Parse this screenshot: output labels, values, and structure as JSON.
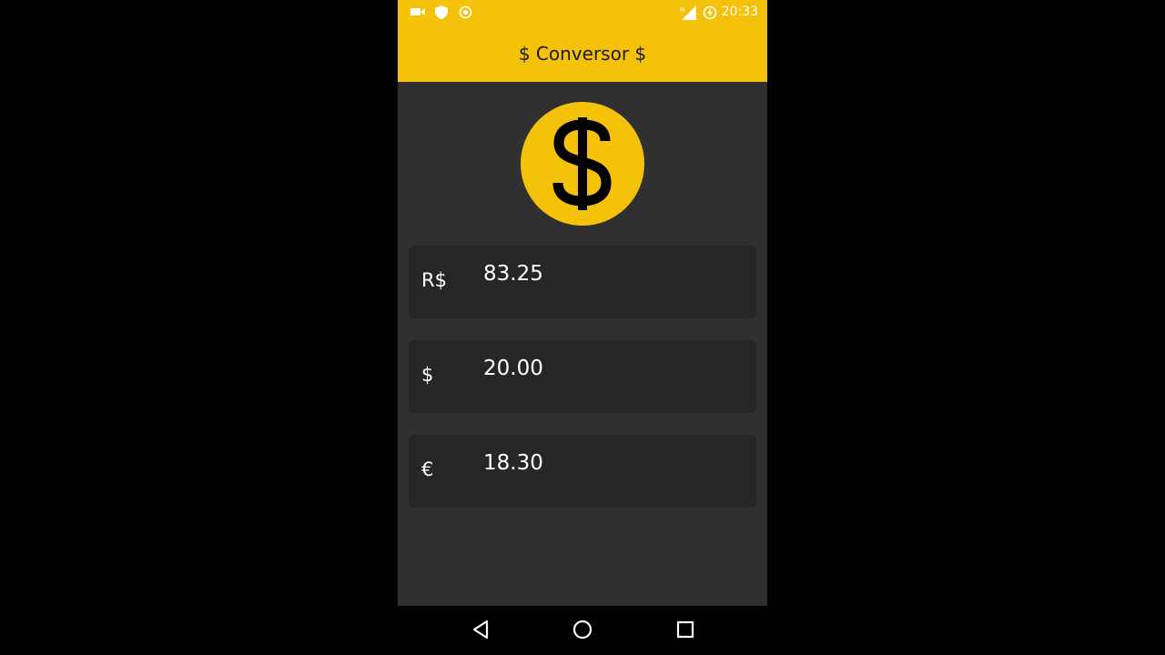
{
  "statusbar": {
    "time": "20:33",
    "icons": [
      "video-camera-icon",
      "shield-icon",
      "target-icon",
      "signal-icon",
      "battery-charging-icon"
    ]
  },
  "appbar": {
    "title": "$ Conversor $",
    "color": "#F5C20B"
  },
  "logo": {
    "icon": "dollar-coin-icon",
    "symbol": "$",
    "color": "#F5C20B"
  },
  "fields": [
    {
      "prefix": "R$",
      "value": "83.25"
    },
    {
      "prefix": "$",
      "value": "20.00"
    },
    {
      "prefix": "€",
      "value": "18.30"
    }
  ],
  "navbar": {
    "icons": [
      "back-icon",
      "home-icon",
      "recents-icon"
    ]
  }
}
